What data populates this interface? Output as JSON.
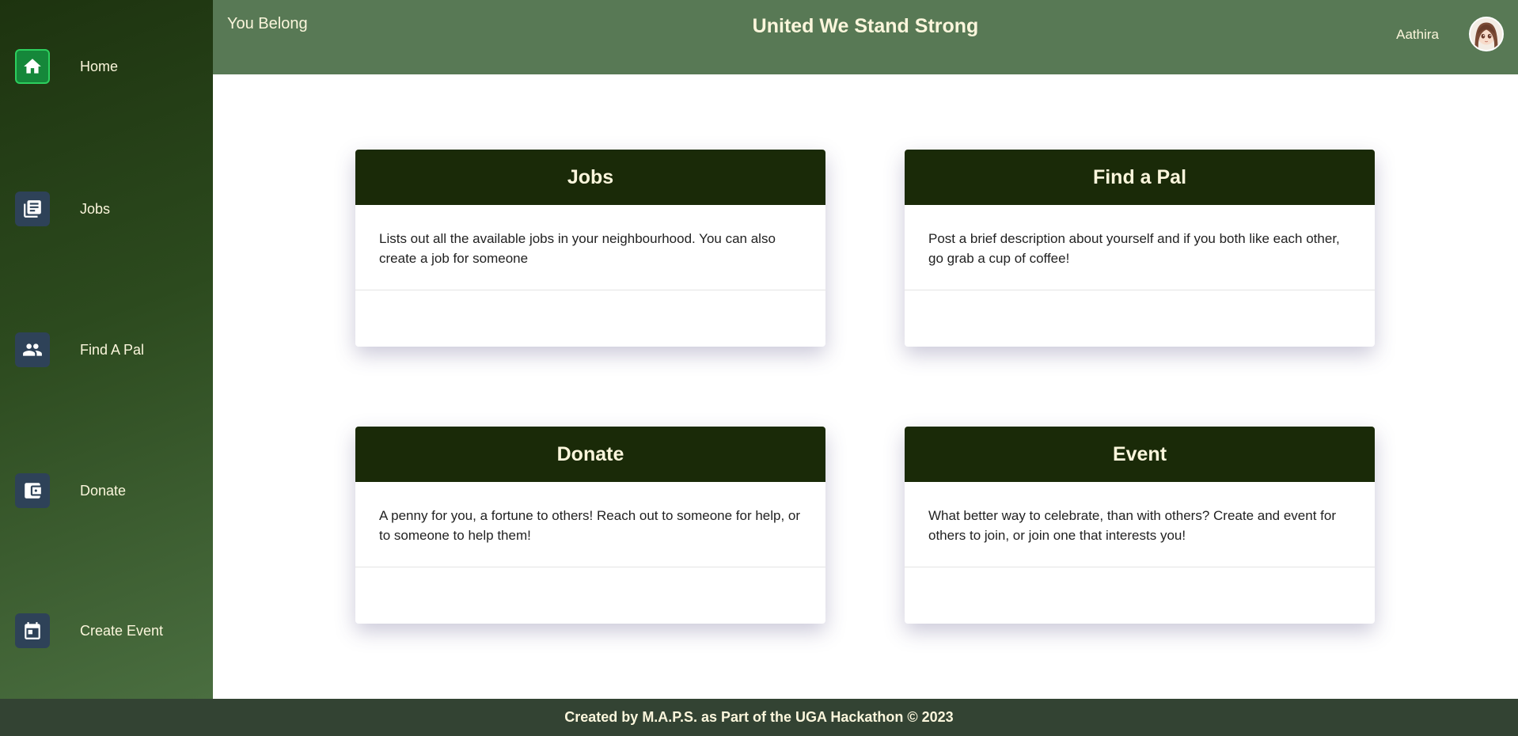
{
  "sidebar": {
    "items": [
      {
        "label": "Home",
        "icon": "home-icon",
        "active": true
      },
      {
        "label": "Jobs",
        "icon": "newspaper-icon",
        "active": false
      },
      {
        "label": "Find A Pal",
        "icon": "people-icon",
        "active": false
      },
      {
        "label": "Donate",
        "icon": "wallet-icon",
        "active": false
      },
      {
        "label": "Create Event",
        "icon": "calendar-icon",
        "active": false
      }
    ]
  },
  "header": {
    "brand": "You Belong",
    "title": "United We Stand Strong",
    "user_name": "Aathira"
  },
  "cards": [
    {
      "title": "Jobs",
      "description": "Lists out all the available jobs in your neighbourhood. You can also create a job for someone"
    },
    {
      "title": "Find a Pal",
      "description": "Post a brief description about yourself and if you both like each other, go grab a cup of coffee!"
    },
    {
      "title": "Donate",
      "description": "A penny for you, a fortune to others! Reach out to someone for help, or to someone to help them!"
    },
    {
      "title": "Event",
      "description": "What better way to celebrate, than with others? Create and event for others to join, or join one that interests you!"
    }
  ],
  "footer": {
    "text": "Created by M.A.P.S. as Part of the UGA Hackathon © 2023"
  },
  "colors": {
    "sidebar_dark": "#1d330f",
    "header_bg": "#587955",
    "card_header_bg": "#1a2a08",
    "active_icon_bg": "#15873a",
    "icon_bg": "#2e4258",
    "footer_bg": "#334333",
    "cream_text": "#fbf6dc"
  }
}
